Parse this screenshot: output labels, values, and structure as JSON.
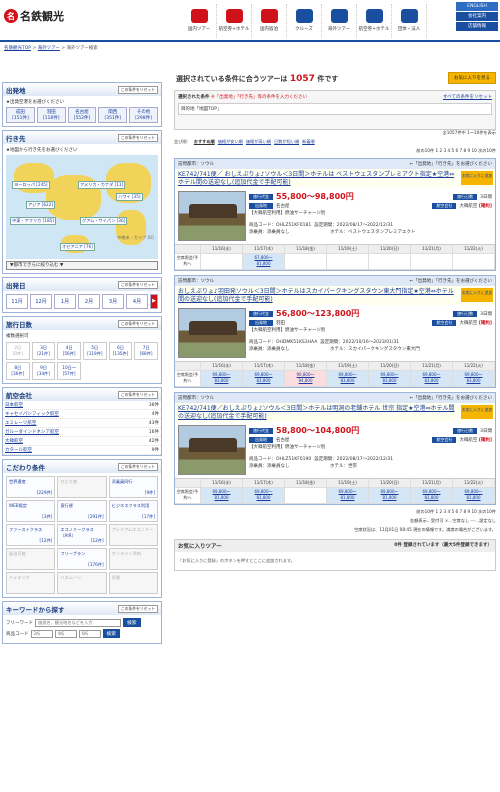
{
  "brand": {
    "name": "名鉄観光",
    "mark": "名"
  },
  "gnav": [
    {
      "label": "国内ツアー",
      "color": "#d0121b"
    },
    {
      "label": "航空券+ホテル",
      "color": "#d0121b"
    },
    {
      "label": "国内宿泊",
      "color": "#d0121b"
    },
    {
      "label": "クルーズ",
      "color": "#1a4fa0"
    },
    {
      "label": "海外ツアー",
      "color": "#1a4fa0"
    },
    {
      "label": "航空券+ホテル",
      "color": "#1a4fa0"
    },
    {
      "label": "団体・法人",
      "color": "#1a4fa0"
    }
  ],
  "hlinks": [
    "ENGLISH",
    "会社案内",
    "店舗情報"
  ],
  "breadcrumb": {
    "home": "名鉄観光TOP",
    "sep1": " > ",
    "section": "海外ツアー",
    "sep2": " > ",
    "current": "海外ツアー検索"
  },
  "side": {
    "depart": {
      "title": "出発地",
      "reset": "この条件をリセット",
      "note": "★出発空港をお選びください",
      "items": [
        "成田\n[151件]",
        "羽田\n[118件]",
        "名古屋\n[552件]",
        "関西\n[351件]",
        "その他\n[298件]"
      ]
    },
    "dest": {
      "title": "行き先",
      "reset": "この条件をリセット",
      "note": "★地図から行き先をお選びください",
      "labels": [
        "ヨーロッパ [245]",
        "アメリカ・カナダ [11]",
        "アジア [622]",
        "ハワイ [35]",
        "中東・アフリカ [185]",
        "グアム・サイパン [36]",
        "オセアニア [76]",
        "中南米・カリブ [0]"
      ],
      "select": "▼都市できらに絞り込む ▼"
    },
    "date": {
      "title": "出発日",
      "reset": "この条件をリセット",
      "months": [
        "11月",
        "12月",
        "1月",
        "2月",
        "3月",
        "4月"
      ]
    },
    "days": {
      "title": "旅行日数",
      "reset": "この条件をリセット",
      "note": "複数選択可",
      "items": [
        "2日\n[0件]",
        "3日\n[21件]",
        "4日\n[56件]",
        "5日\n[119件]",
        "6日\n[135件]",
        "7日\n[68件]",
        "8日\n[36件]",
        "9日\n[34件]",
        "10日〜\n[57件]"
      ]
    },
    "air": {
      "title": "航空会社",
      "reset": "この条件をリセット",
      "items": [
        [
          "日本航空",
          "36件"
        ],
        [
          "キャセイパシフィック航空",
          "4件"
        ],
        [
          "エミレーツ航空",
          "43件"
        ],
        [
          "ガルーダインドネシア航空",
          "16件"
        ],
        [
          "大韓航空",
          "42件"
        ],
        [
          "カタール航空",
          "9件"
        ]
      ]
    },
    "kodawari": {
      "title": "こだわり条件",
      "reset": "この条件をリセット",
      "items": [
        [
          "世界遺産",
          "[229件]"
        ],
        [
          "ひとり旅",
          ""
        ],
        [
          "添乗員同行",
          "[9件]"
        ],
        [
          "WEB限定",
          "[3件]"
        ],
        [
          "直行便",
          "[291件]"
        ],
        [
          "ビジネスクラス利用",
          "[17件]"
        ],
        [
          "ファーストクラス",
          "[12件]"
        ],
        [
          "エコノミークラス（AIR）",
          "[12件]"
        ],
        [
          "プレミアムエコノミー",
          ""
        ],
        [
          "延泊可能",
          ""
        ],
        [
          "フリープラン",
          "[176件]"
        ],
        [
          "オンライン予約",
          ""
        ],
        [
          "ハイキング",
          ""
        ],
        [
          "ハネムーン",
          ""
        ],
        [
          "早割",
          ""
        ]
      ]
    },
    "keyword": {
      "title": "キーワードから探す",
      "reset": "この条件をリセット",
      "free_label": "フリーワード",
      "free_ph": "施設名、観光地名などを入力",
      "code_label": "商品コード",
      "c1": "2桁",
      "c2": "4桁",
      "c3": "6桁",
      "btn": "検索"
    }
  },
  "main": {
    "count_pre": "選択されている条件に合うツアーは",
    "count": "1057",
    "count_post": "件です",
    "favbtn": "お気に入りを見る",
    "cond_label": "選択された条件",
    "cond_red": "※「出発地」「行き先」等の条件を入力ください",
    "cond_reset": "すべての条件をリセット",
    "cond_text": "目的地「地図TOP」",
    "sort_label": "並び順：",
    "sort": [
      "おすすめ順",
      "価格が安い順",
      "価格が高い順",
      "日数が短い順",
      "新着順"
    ],
    "pager": "全1057件中 1〜10件を表示",
    "pages": "前の10件 1 2 3 4 5 6 7 8 9 10 次の10件",
    "tours": [
      {
        "dest": "訪問都市：ソウル",
        "badge": "←「出発地」「行き先」をお選びください",
        "title": "KE742/741便／ おしえぷりょ♪ソウル＜3日間＞ホテルは ベストウェスタンプレミアクト指定★空港⇔ホテル間の送迎なし(追加代金で手配可能)",
        "fav": "お気に入りに追加",
        "tag1": "旅行代金",
        "price": "55,800〜98,800円",
        "tag2": "出発地",
        "dep": "名古屋",
        "tag3": "旅行日数",
        "days": "3日間",
        "tag4": "航空会社",
        "air": "大韓航空",
        "status": "[確約]",
        "text": "【大韓航空利用】燃油サーチャージ別",
        "code": "商品コード：OHLZ51KF0181",
        "period": "設定期間：2022/08/17〜2022/12/31",
        "guide": "添乗員：添乗員なし",
        "hotel": "ホテル：ベストウェスタンプレミアエクト",
        "dates": [
          "11/16(水)",
          "11/17(木)",
          "11/18(金)",
          "11/19(土)",
          "11/20(日)",
          "11/21(月)",
          "11/22(火)"
        ],
        "row": [
          "空席照会/予約へ",
          "",
          "67,800〜\n81,800",
          "",
          "",
          "",
          "",
          ""
        ]
      },
      {
        "dest": "訪問都市：ソウル",
        "badge": "←「出発地」「行き先」をお選びください",
        "title": "おしえぷりょ♪羽田発ソウル＜3日間＞ホテルはスカイパークキングスタウン東大門指定★空港⇔ホテル間の送迎なし(追加代金で手配可能)",
        "fav": "お気に入りに追加",
        "tag1": "旅行代金",
        "price": "56,800〜123,800円",
        "tag2": "出発地",
        "dep": "羽田",
        "tag3": "旅行日数",
        "days": "3日間",
        "tag4": "航空会社",
        "air": "大韓航空",
        "status": "[確約]",
        "text": "【大韓航空利用】燃油サーチャージ別",
        "code": "商品コード：OHDMK51KS3HAA",
        "period": "設定期間：2022/10/16〜2023/01/31",
        "guide": "添乗員：添乗員なし",
        "hotel": "ホテル：スカイパークキングスタウン東大門",
        "dates": [
          "11/16(水)",
          "11/17(木)",
          "11/18(金)",
          "11/19(土)",
          "11/20(日)",
          "11/21(月)",
          "11/22(火)"
        ],
        "row": [
          "空席照会/予約へ",
          "69,800〜\n83,800",
          "69,800〜\n83,800",
          "90,800〜\n94,800",
          "69,800〜\n83,800",
          "69,800〜\n83,800",
          "69,800〜\n83,800",
          "69,800〜\n83,800"
        ]
      },
      {
        "dest": "訪問都市：ソウル",
        "badge": "←「出発地」「行き先」をお選びください",
        "title": "KE742/741便／おしえぷりょ♪ソウル＜3日間＞ホテルは明洞の老舗ホテル 世宗 指定★空港⇔ホテル間の送迎なし(追加代金で手配可能)",
        "fav": "お気に入りに追加",
        "tag1": "旅行代金",
        "price": "58,800〜104,800円",
        "tag2": "出発地",
        "dep": "名古屋",
        "tag3": "旅行日数",
        "days": "3日間",
        "tag4": "航空会社",
        "air": "大韓航空",
        "status": "[確約]",
        "text": "【大韓航空利用】燃油サーチャージ別",
        "code": "商品コード：OHLZ51KF0190",
        "period": "設定期間：2022/08/17〜2022/12/31",
        "guide": "添乗員：添乗員なし",
        "hotel": "ホテル：世宗",
        "dates": [
          "11/16(水)",
          "11/17(木)",
          "11/18(金)",
          "11/19(土)",
          "11/20(日)",
          "11/21(月)",
          "11/22(火)"
        ],
        "row": [
          "空席照会/予約へ",
          "69,800〜\n81,800",
          "69,800〜\n81,800",
          "",
          "69,800〜\n81,800",
          "69,800〜\n81,800",
          "69,800〜\n81,800",
          "69,800〜\n81,800"
        ]
      }
    ],
    "legend": "金額表示…受付可 ×…空席なし ---…設定なし",
    "legend2": "空席状況は、11月01日 08:45 現在の情報です。満席の場合がございます。",
    "fav_title": "お気に入りツアー",
    "fav_count": "0件 登録されています（最大5件登録できます）",
    "fav_note": "「お気に入りに登録」のボタンを押すとここに追加されます。"
  }
}
